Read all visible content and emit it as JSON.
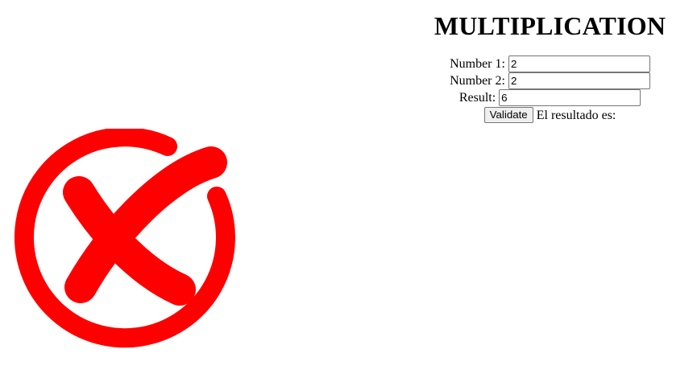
{
  "page": {
    "title": "MULTIPLICATION"
  },
  "form": {
    "number1": {
      "label": "Number 1:",
      "value": "2"
    },
    "number2": {
      "label": "Number 2:",
      "value": "2"
    },
    "result": {
      "label": "Result:",
      "value": "6"
    },
    "validate_label": "Validate",
    "message": "El resultado es:"
  },
  "feedback": {
    "icon": "wrong-answer-x-icon",
    "color": "#ff0000"
  }
}
